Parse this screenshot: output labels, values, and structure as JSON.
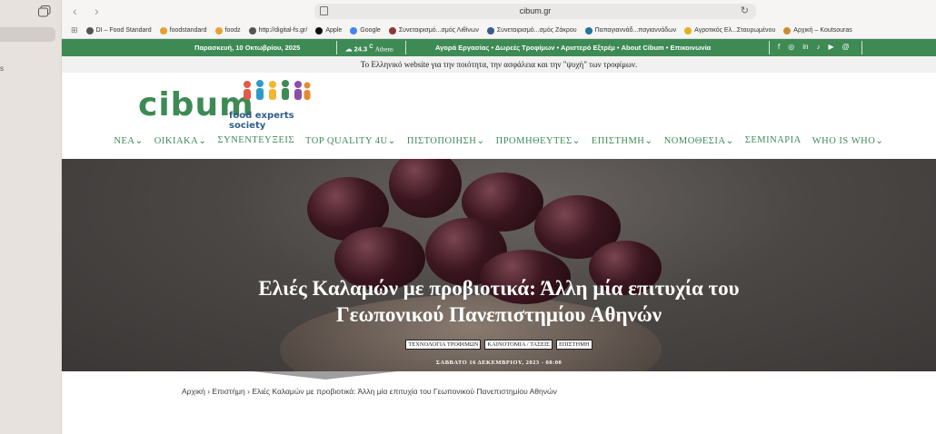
{
  "browser": {
    "url": "cibum.gr"
  },
  "sidebar": {
    "fragment_text": "s"
  },
  "bookmarks": [
    {
      "label": "DI – Food Standard",
      "icon": "globe-icon",
      "color": "#555555"
    },
    {
      "label": "foodstandard",
      "icon": "foodstandard-icon",
      "color": "#e8a030"
    },
    {
      "label": "foodz",
      "icon": "foodz-icon",
      "color": "#e8a030"
    },
    {
      "label": "http://digital-fs.gr/",
      "icon": "globe-icon",
      "color": "#555555"
    },
    {
      "label": "Apple",
      "icon": "apple-icon",
      "color": "#111111"
    },
    {
      "label": "Google",
      "icon": "google-icon",
      "color": "#4285f4"
    },
    {
      "label": "Συνεταιρισμό...σμός Λιθίνων",
      "icon": "coop-icon",
      "color": "#8b3a3a"
    },
    {
      "label": "Συνεταιρισμό...σμός Ζάκρου",
      "icon": "coop-icon",
      "color": "#3a5a8b"
    },
    {
      "label": "Παπαγιαννάδ...παγιαννάδων",
      "icon": "wordpress-icon",
      "color": "#21759b"
    },
    {
      "label": "Αγροτικός Ελ...Σταυρωμένου",
      "icon": "agro-icon",
      "color": "#e0b020"
    },
    {
      "label": "Αρχική – Koutsouras",
      "icon": "koutsouras-icon",
      "color": "#d08a30"
    }
  ],
  "topbar": {
    "date": "Παρασκευή, 10 Οκτωβρίου, 2025",
    "weather_temp": "24.3",
    "weather_unit": "C",
    "weather_city": "Athens",
    "links": "Αγορά Εργασίας • Δωρεές Τροφίμων • Αριστερό Εξτρέμ • About Cibum • Επικοινωνία",
    "social": [
      "f",
      "◎",
      "in",
      "♪",
      "▶",
      "@"
    ]
  },
  "tagline": "Το Ελληνικό website για την ποιότητα, την ασφάλεια και την \"ψυχή\" των τροφίμων.",
  "logo": {
    "word": "cibum",
    "sub": "food experts society"
  },
  "nav": [
    "ΝΕΑ⌄",
    "ΟΙΚΙΑΚΑ⌄",
    "ΣΥΝΕΝΤΕΥΞΕΙΣ",
    "TOP QUALITY 4U⌄",
    "ΠΙΣΤΟΠΟΙΗΣΗ⌄",
    "ΠΡΟΜΗΘΕΥΤΕΣ⌄",
    "ΕΠΙΣΤΗΜΗ⌄",
    "ΝΟΜΟΘΕΣΙΑ⌄",
    "ΣΕΜΙΝΑΡΙΑ",
    "WHO IS WHO⌄"
  ],
  "article": {
    "title_line1": "Ελιές Καλαμών με προβιοτικά: Άλλη μία επιτυχία του",
    "title_line2": "Γεωπονικού Πανεπιστημίου Αθηνών",
    "categories": [
      "ΤΕΧΝΟΛΟΓΙΑ ΤΡΟΦΙΜΩΝ",
      "ΚΑΙΝΟΤΟΜΙΑ / ΤΑΣΕΙΣ",
      "ΕΠΙΣΤΗΜΗ"
    ],
    "date": "ΣΑΒΒΑΤΟ 16 ΔΕΚΕΜΒΡΙΟΥ, 2023 - 08:00"
  },
  "breadcrumb": "Αρχική › Επιστήμη › Ελιές Καλαμών με προβιοτικά: Άλλη μία επιτυχία του Γεωπονικού Πανεπιστημίου Αθηνών",
  "colors": {
    "brand_green": "#3e8a55",
    "logo_blue": "#2e5e8a"
  }
}
